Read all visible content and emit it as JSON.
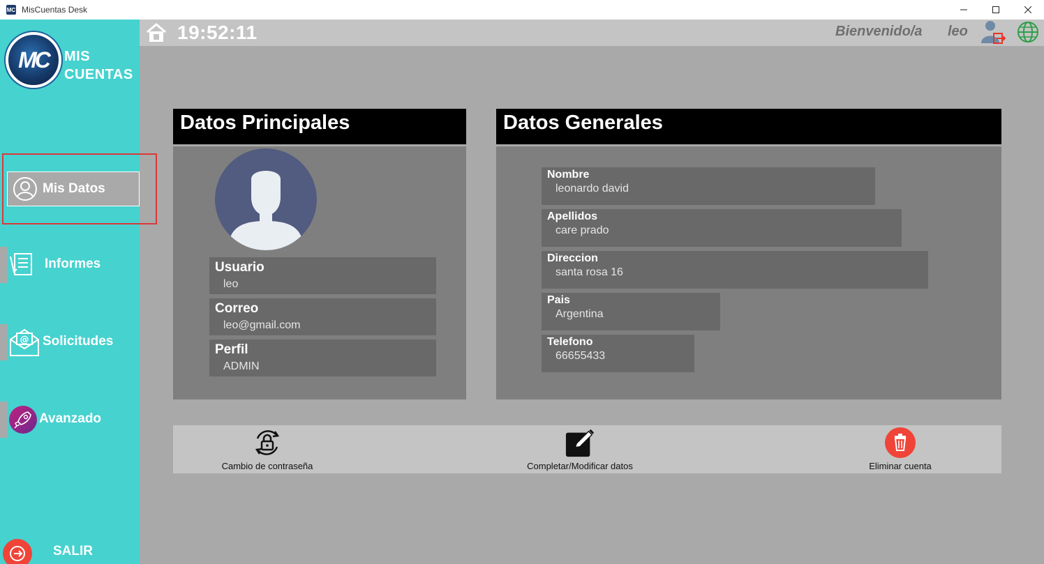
{
  "window": {
    "title": "MisCuentas Desk",
    "icon_text": "MC",
    "controls": [
      "minimize-icon",
      "maximize-icon",
      "close-icon"
    ]
  },
  "sidebar": {
    "logo": {
      "mark": "MC",
      "line1": "MIS",
      "line2": "CUENTAS"
    },
    "items": [
      {
        "label": "Mis Datos",
        "icon": "user-circle-icon",
        "active": true
      },
      {
        "label": "Informes",
        "icon": "report-icon"
      },
      {
        "label": "Solicitudes",
        "icon": "mail-icon"
      },
      {
        "label": "Avanzado",
        "icon": "rocket-icon"
      }
    ],
    "exit": {
      "label": "SALIR",
      "icon": "exit-icon"
    }
  },
  "header": {
    "time": "19:52:11",
    "welcome": "Bienvenido/a",
    "username": "leo"
  },
  "principal": {
    "title": "Datos Principales",
    "fields": [
      {
        "label": "Usuario",
        "value": "leo"
      },
      {
        "label": "Correo",
        "value": "leo@gmail.com"
      },
      {
        "label": "Perfil",
        "value": "ADMIN"
      }
    ]
  },
  "general": {
    "title": "Datos Generales",
    "fields": [
      {
        "label": "Nombre",
        "value": "leonardo david"
      },
      {
        "label": "Apellidos",
        "value": "care prado"
      },
      {
        "label": "Direccion",
        "value": "santa rosa 16"
      },
      {
        "label": "Pais",
        "value": "Argentina"
      },
      {
        "label": "Telefono",
        "value": "66655433"
      }
    ]
  },
  "actions": [
    {
      "label": "Cambio de contraseña",
      "icon": "lock-rotate-icon"
    },
    {
      "label": "Completar/Modificar datos",
      "icon": "edit-icon"
    },
    {
      "label": "Eliminar cuenta",
      "icon": "trash-icon"
    }
  ],
  "colors": {
    "sidebar": "#46d2cf",
    "background": "#a9a9a9",
    "panel_head": "#000000",
    "panel_body": "#7f7f7f",
    "field": "#696969",
    "danger": "#f04438",
    "highlight": "#d9393a"
  }
}
